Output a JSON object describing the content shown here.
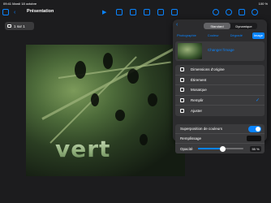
{
  "status": {
    "time": "09:41",
    "date": "Mardi 18 octobre",
    "battery": "100 %"
  },
  "toolbar": {
    "title": "Présentation"
  },
  "slides_button": {
    "label": "1 sur 1"
  },
  "canvas": {
    "text": "vert"
  },
  "popover": {
    "segments": [
      "Standard",
      "Dynamique"
    ],
    "active_segment": "Standard",
    "tabs": [
      "Photographie",
      "Couleur",
      "Dégradé",
      "Image"
    ],
    "active_tab": "Image",
    "change_image": "Changer l'image",
    "fit_options": [
      "Dimensions d'origine",
      "Étirement",
      "Mosaïque",
      "Remplir",
      "Ajuster"
    ],
    "selected_fit": "Remplir",
    "overlay_label": "Superposition de couleurs",
    "overlay_on": true,
    "fill_label": "Remplissage",
    "fill_color": "#111111",
    "opacity_label": "Opacité",
    "opacity_value": "55 %",
    "opacity_fraction": 0.55
  },
  "colors": {
    "accent": "#0a84ff",
    "background": "#1c1c1e",
    "panel": "#2c2c2e"
  }
}
